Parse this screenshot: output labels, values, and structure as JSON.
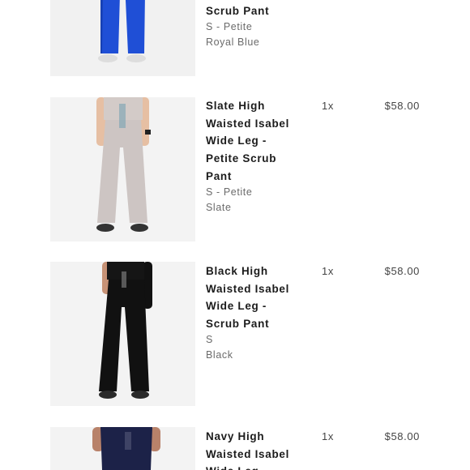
{
  "cart": {
    "items": [
      {
        "name_lines": [
          "Scrub Pant"
        ],
        "size": "S - Petite",
        "color": "Royal Blue",
        "pant_color": "#1f4fd6",
        "skin_color": "#e8c4a8"
      },
      {
        "name_lines": [
          "Slate High",
          "Waisted Isabel",
          "Wide Leg -",
          "Petite Scrub",
          "Pant"
        ],
        "size": "S - Petite",
        "color": "Slate",
        "qty": "1x",
        "price": "$58.00",
        "pant_color": "#cdc5c3",
        "skin_color": "#e6bfa3"
      },
      {
        "name_lines": [
          "Black High",
          "Waisted Isabel",
          "Wide Leg -",
          "Scrub Pant"
        ],
        "size": "S",
        "color": "Black",
        "qty": "1x",
        "price": "$58.00",
        "pant_color": "#111111",
        "skin_color": "#c79276"
      },
      {
        "name_lines": [
          "Navy High",
          "Waisted Isabel",
          "Wide Leg -"
        ],
        "qty": "1x",
        "price": "$58.00",
        "pant_color": "#1c2248",
        "skin_color": "#b8826a"
      }
    ]
  }
}
